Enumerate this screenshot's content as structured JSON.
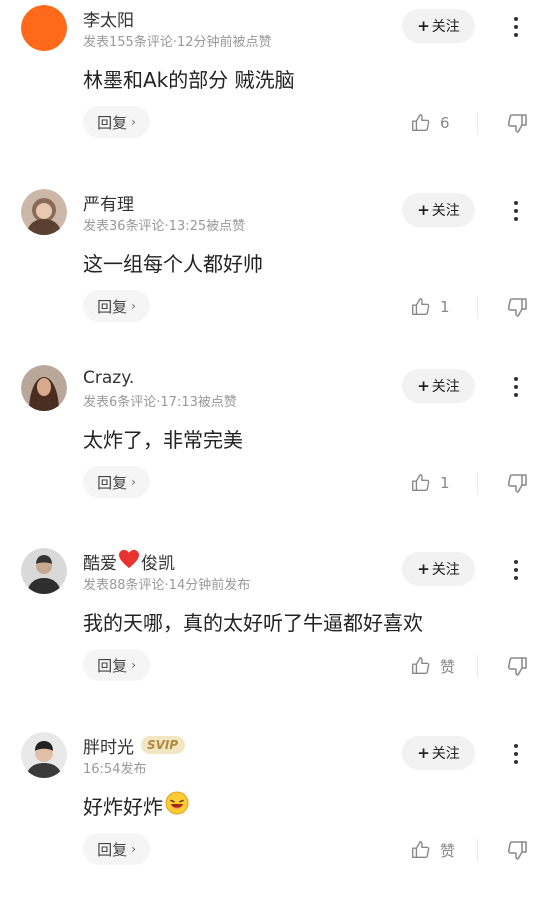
{
  "follow_label": "关注",
  "reply_label": "回复",
  "comments": [
    {
      "user": "李太阳",
      "meta": "发表155条评论·12分钟前被点赞",
      "content": "林墨和Ak的部分  贼洗脑",
      "likes": "6",
      "avatar_color": "#ff6a1a"
    },
    {
      "user": "严有理",
      "meta": "发表36条评论·13:25被点赞",
      "content": "这一组每个人都好帅",
      "likes": "1",
      "avatar_color": "#8a6a58"
    },
    {
      "user": "Crazy.",
      "meta": "发表6条评论·17:13被点赞",
      "content": "太炸了，非常完美",
      "likes": "1",
      "avatar_color": "#6b4a3a"
    },
    {
      "user_part1": "酷爱",
      "user_part2": "俊凯",
      "meta": "发表88条评论·14分钟前发布",
      "content": "我的天哪，真的太好听了牛逼都好喜欢",
      "likes": "赞",
      "avatar_color": "#5a5a5a"
    },
    {
      "user": "胖时光",
      "badge": "SVIP",
      "meta": "16:54发布",
      "content": "好炸好炸",
      "likes": "赞",
      "avatar_color": "#3a3a3a"
    }
  ]
}
